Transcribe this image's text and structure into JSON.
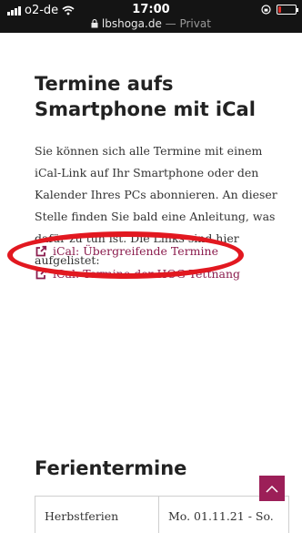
{
  "status_bar": {
    "carrier": "o2-de",
    "time": "17:00",
    "url": "lbshoga.de",
    "url_suffix": " — Privat",
    "battery_level": 0.15
  },
  "page": {
    "title": "Termine aufs Smartphone mit iCal",
    "intro": "Sie können sich alle Termine mit einem iCal-Link auf Ihr Smartphone oder den Kalender Ihres PCs abonnieren. An dieser Stelle finden Sie bald eine Anleitung, was dafür zu tun ist. Die Links sind hier aufgelistet:",
    "links": [
      {
        "label": "iCal: Übergreifende Termine",
        "icon": "external-link-icon"
      },
      {
        "label": "iCal: Termine der HOG Tettnang",
        "icon": "external-link-icon"
      }
    ],
    "section_title": "Ferientermine",
    "table": [
      [
        "Herbstferien",
        "Mo. 01.11.21 - So."
      ]
    ]
  },
  "colors": {
    "accent": "#8b1d4e",
    "highlight": "#e21820",
    "scroll_button": "#9c1f58"
  }
}
